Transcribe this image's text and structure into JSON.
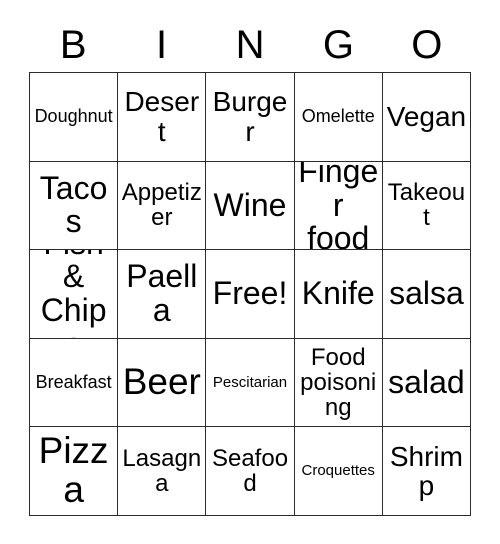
{
  "header": {
    "letters": [
      "B",
      "I",
      "N",
      "G",
      "O"
    ]
  },
  "grid": {
    "columns": 5,
    "rows": 5,
    "border_color": "#2b2b2b",
    "cell_background": "#ffffff",
    "text_color": "#000000",
    "cells": [
      [
        {
          "label": "Doughnut",
          "size": "sm"
        },
        {
          "label": "Desert",
          "size": "lg"
        },
        {
          "label": "Burger",
          "size": "lg"
        },
        {
          "label": "Omelette",
          "size": "sm"
        },
        {
          "label": "Vegan",
          "size": "lg"
        }
      ],
      [
        {
          "label": "Tacos",
          "size": "xl"
        },
        {
          "label": "Appetizer",
          "size": "md"
        },
        {
          "label": "Wine",
          "size": "xl"
        },
        {
          "label": "Finger food",
          "size": "xl"
        },
        {
          "label": "Takeout",
          "size": "md"
        }
      ],
      [
        {
          "label": "Fish & Chips",
          "size": "xl"
        },
        {
          "label": "Paella",
          "size": "xl"
        },
        {
          "label": "Free!",
          "size": "xl"
        },
        {
          "label": "Knife",
          "size": "xl"
        },
        {
          "label": "salsa",
          "size": "xl"
        }
      ],
      [
        {
          "label": "Breakfast",
          "size": "sm"
        },
        {
          "label": "Beer",
          "size": "xxl"
        },
        {
          "label": "Pescitarian",
          "size": "xs"
        },
        {
          "label": "Food poisoning",
          "size": "md"
        },
        {
          "label": "salad",
          "size": "xl"
        }
      ],
      [
        {
          "label": "Pizza",
          "size": "xxl"
        },
        {
          "label": "Lasagna",
          "size": "md"
        },
        {
          "label": "Seafood",
          "size": "md"
        },
        {
          "label": "Croquettes",
          "size": "xs"
        },
        {
          "label": "Shrimp",
          "size": "lg"
        }
      ]
    ]
  }
}
